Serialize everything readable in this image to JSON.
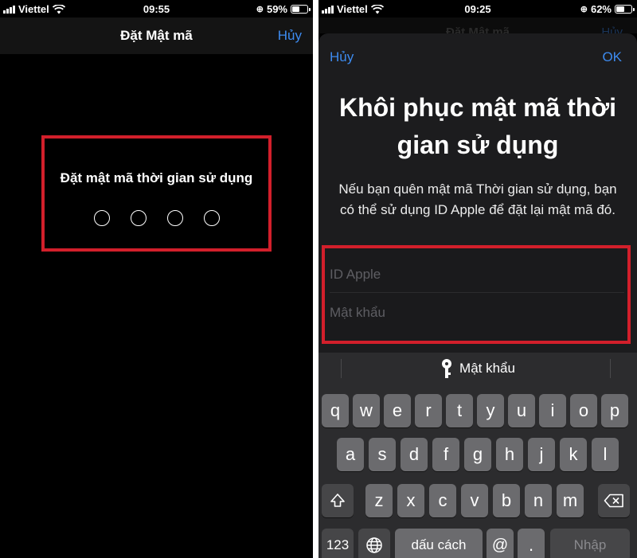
{
  "left_screen": {
    "status": {
      "carrier": "Viettel",
      "time": "09:55",
      "battery": "59%",
      "battery_level": 0.59
    },
    "nav": {
      "title": "Đặt Mật mã",
      "cancel": "Hủy"
    },
    "passcode": {
      "title": "Đặt mật mã thời gian sử dụng",
      "digit_count": 4
    }
  },
  "right_screen": {
    "status": {
      "carrier": "Viettel",
      "time": "09:25",
      "battery": "62%",
      "battery_level": 0.62
    },
    "behind_nav": {
      "title": "Đặt Mật mã",
      "cancel": "Hủy"
    },
    "sheet": {
      "cancel": "Hủy",
      "ok": "OK",
      "title": "Khôi phục mật mã thời gian sử dụng",
      "description": "Nếu bạn quên mật mã Thời gian sử dụng, bạn có thể sử dụng ID Apple để đặt lại mật mã đó.",
      "apple_id_placeholder": "ID Apple",
      "password_placeholder": "Mật khẩu"
    },
    "keyboard": {
      "suggestion": "Mật khẩu",
      "row1": [
        "q",
        "w",
        "e",
        "r",
        "t",
        "y",
        "u",
        "i",
        "o",
        "p"
      ],
      "row2": [
        "a",
        "s",
        "d",
        "f",
        "g",
        "h",
        "j",
        "k",
        "l"
      ],
      "row3": [
        "z",
        "x",
        "c",
        "v",
        "b",
        "n",
        "m"
      ],
      "numbers_key": "123",
      "space_key": "dấu cách",
      "at_key": "@",
      "dot_key": ".",
      "return_key": "Nhập"
    }
  },
  "colors": {
    "accent": "#3d8bf0",
    "highlight": "#d21f2b"
  },
  "icons": [
    "signal-icon",
    "wifi-icon",
    "orientation-lock-icon",
    "battery-icon",
    "key-icon",
    "shift-icon",
    "delete-icon",
    "globe-icon"
  ]
}
